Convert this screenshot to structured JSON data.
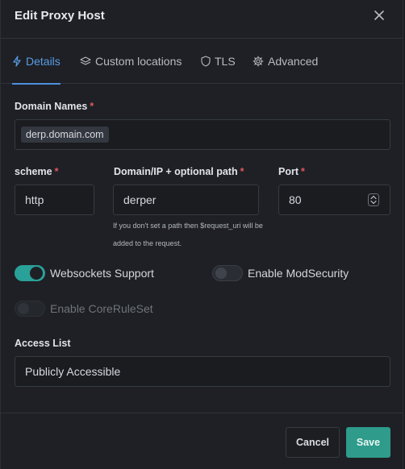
{
  "dialog": {
    "title": "Edit Proxy Host"
  },
  "tabs": [
    {
      "label": "Details",
      "icon": "bolt-icon",
      "active": true
    },
    {
      "label": "Custom locations",
      "icon": "layers-icon",
      "active": false
    },
    {
      "label": "TLS",
      "icon": "shield-icon",
      "active": false
    },
    {
      "label": "Advanced",
      "icon": "gear-icon",
      "active": false
    }
  ],
  "form": {
    "domain_names": {
      "label": "Domain Names",
      "required": "*",
      "tags": [
        "derp.domain.com"
      ]
    },
    "scheme": {
      "label": "scheme",
      "required": "*",
      "value": "http"
    },
    "host": {
      "label": "Domain/IP + optional path",
      "required": "*",
      "value": "derper",
      "hint": "If you don't set a path then $request_uri will be added to the request."
    },
    "port": {
      "label": "Port",
      "required": "*",
      "value": "80"
    },
    "websockets": {
      "label": "Websockets Support",
      "enabled": true
    },
    "modsecurity": {
      "label": "Enable ModSecurity",
      "enabled": false
    },
    "coreruleset": {
      "label": "Enable CoreRuleSet",
      "enabled": false,
      "disabled": true
    },
    "access_list": {
      "label": "Access List",
      "value": "Publicly Accessible"
    }
  },
  "footer": {
    "cancel_label": "Cancel",
    "save_label": "Save"
  },
  "colors": {
    "accent": "#2e9b8b",
    "tab_active": "#5a9ce6",
    "required": "#e0565c"
  }
}
